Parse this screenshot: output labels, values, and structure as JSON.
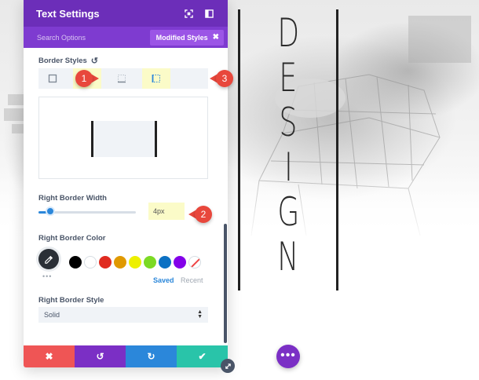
{
  "panel": {
    "title": "Text Settings",
    "search_placeholder": "Search Options",
    "modified_chip_label": "Modified Styles",
    "modified_chip_close": "✖",
    "header_icons": [
      "expand-icon",
      "sidebar-toggle-icon"
    ]
  },
  "border_styles": {
    "label": "Border Styles",
    "tabs": [
      {
        "name": "all-borders",
        "active": false
      },
      {
        "name": "top-border",
        "active": true
      },
      {
        "name": "bottom-border",
        "active": false
      },
      {
        "name": "left-border",
        "active": true
      }
    ]
  },
  "right_border_width": {
    "label": "Right Border Width",
    "value": "4px",
    "slider_fraction": 0.1
  },
  "right_border_color": {
    "label": "Right Border Color",
    "more_dots": "•••",
    "swatches": [
      "#000000",
      "#ffffff",
      "#e02b20",
      "#e09900",
      "#edf000",
      "#7cda24",
      "#0c71c3",
      "#8300e9",
      "none"
    ],
    "tab_saved": "Saved",
    "tab_recent": "Recent"
  },
  "right_border_style": {
    "label": "Right Border Style",
    "value": "Solid"
  },
  "footer": {
    "cancel_icon": "✖",
    "undo_icon": "↺",
    "redo_icon": "↻",
    "save_icon": "✔"
  },
  "callouts": [
    "1",
    "2",
    "3"
  ],
  "design_letters": [
    "D",
    "E",
    "S",
    "I",
    "G",
    "N"
  ],
  "more_button": "•••",
  "colors": {
    "panel_header": "#6c2eb9",
    "search_bar": "#7e3bd0",
    "accent_blue": "#2b87da",
    "modified_yellow": "#fbfbc8",
    "cancel_red": "#ef5555",
    "undo_purple": "#7b2fc5",
    "redo_blue": "#2b87da",
    "save_teal": "#29c4a9",
    "callout_red": "#e8473c"
  }
}
